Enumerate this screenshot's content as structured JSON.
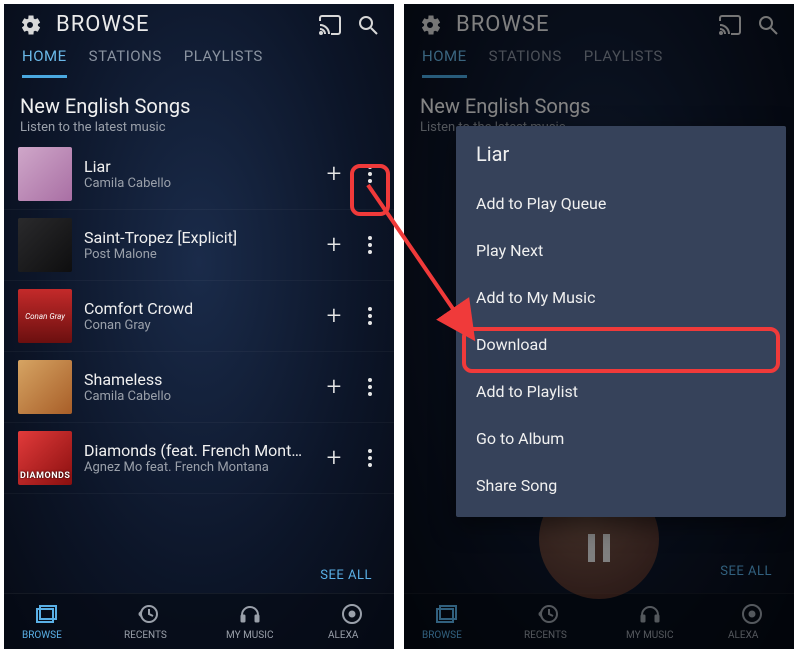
{
  "screens": {
    "left": {
      "header_title": "BROWSE",
      "tabs": [
        "HOME",
        "STATIONS",
        "PLAYLISTS"
      ],
      "active_tab_index": 0,
      "section": {
        "title": "New English Songs",
        "subtitle": "Listen to the latest music"
      },
      "songs": [
        {
          "title": "Liar",
          "artist": "Camila Cabello",
          "art_bg": "linear-gradient(135deg,#cfa7c9,#a96fa4)"
        },
        {
          "title": "Saint-Tropez [Explicit]",
          "artist": "Post Malone",
          "art_bg": "linear-gradient(135deg,#2a2a2c,#0e0e0f)"
        },
        {
          "title": "Comfort Crowd",
          "artist": "Conan Gray",
          "art_bg": "linear-gradient(180deg,#c42a2a,#6b0f0f)",
          "art_text": "Conan Gray"
        },
        {
          "title": "Shameless",
          "artist": "Camila Cabello",
          "art_bg": "linear-gradient(135deg,#d6a463,#a85e28)"
        },
        {
          "title": "Diamonds (feat. French Mont…",
          "artist": "Agnez Mo feat. French Montana",
          "art_bg": "linear-gradient(135deg,#e23b3b,#8a0f0f)",
          "art_label": "DIAMONDS"
        }
      ],
      "see_all": "SEE ALL",
      "nav": [
        {
          "label": "BROWSE",
          "icon": "browse"
        },
        {
          "label": "RECENTS",
          "icon": "recents"
        },
        {
          "label": "MY MUSIC",
          "icon": "mymusic"
        },
        {
          "label": "ALEXA",
          "icon": "alexa"
        }
      ],
      "active_nav_index": 0
    },
    "right": {
      "header_title": "BROWSE",
      "tabs": [
        "HOME",
        "STATIONS",
        "PLAYLISTS"
      ],
      "active_tab_index": 0,
      "section": {
        "title": "New English Songs",
        "subtitle": "Listen to the latest music"
      },
      "see_all": "SEE ALL",
      "nav": [
        {
          "label": "BROWSE",
          "icon": "browse"
        },
        {
          "label": "RECENTS",
          "icon": "recents"
        },
        {
          "label": "MY MUSIC",
          "icon": "mymusic"
        },
        {
          "label": "ALEXA",
          "icon": "alexa"
        }
      ],
      "active_nav_index": 0,
      "menu": {
        "title": "Liar",
        "items": [
          "Add to Play Queue",
          "Play Next",
          "Add to My Music",
          "Download",
          "Add to Playlist",
          "Go to Album",
          "Share Song"
        ],
        "highlighted_index": 3
      }
    }
  },
  "annotation_color": "#f03a3a"
}
